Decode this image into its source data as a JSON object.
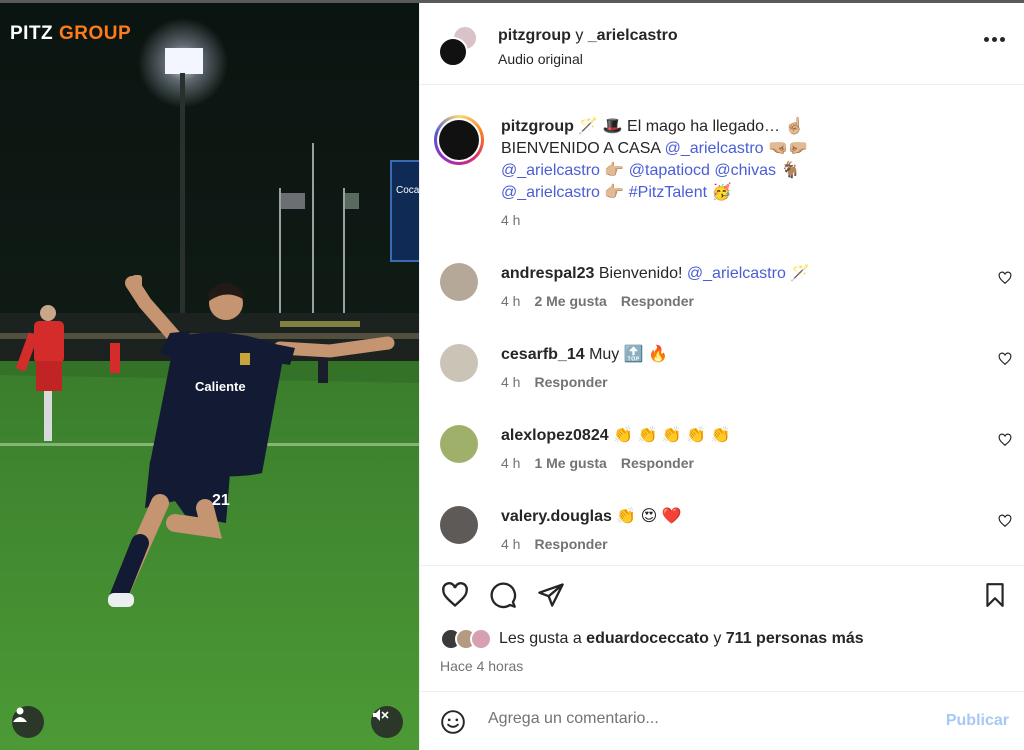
{
  "media": {
    "brand_prefix": "PITZ",
    "brand_suffix": "GROUP",
    "jersey_sponsor": "Caliente",
    "stadium_sign": "Coca-Cola",
    "player_number": "21"
  },
  "header": {
    "user1": "pitzgroup",
    "conjunction": "y",
    "user2": "_arielcastro",
    "subtitle": "Audio original"
  },
  "caption": {
    "username": "pitzgroup",
    "text1": " 🪄 🎩 El mago ha llegado… ☝🏼",
    "text2": "BIENVENIDO A CASA ",
    "mention1": "@_arielcastro",
    "emoji2": " 🤜🏼🤛🏼",
    "mention2": "@_arielcastro",
    "emoji3": " 👉🏼 ",
    "mention3": "@tapatiocd",
    "mention4": "@chivas",
    "emoji4": " 🐐",
    "mention5": "@_arielcastro",
    "emoji5": " 👉🏼 ",
    "hashtag": "#PitzTalent",
    "emoji6": " 🥳",
    "time": "4 h"
  },
  "comments": [
    {
      "username": "andrespal23",
      "text": " Bienvenido! ",
      "mention": "@_arielcastro",
      "emoji": " 🪄",
      "time": "4 h",
      "likes": "2 Me gusta",
      "reply": "Responder",
      "avatar_color": "#b5a898"
    },
    {
      "username": "cesarfb_14",
      "text": " Muy ",
      "mention": "",
      "emoji": "🔝 🔥",
      "time": "4 h",
      "likes": "",
      "reply": "Responder",
      "avatar_color": "#c9c4b5"
    },
    {
      "username": "alexlopez0824",
      "text": " ",
      "mention": "",
      "emoji": "👏 👏 👏 👏 👏",
      "time": "4 h",
      "likes": "1 Me gusta",
      "reply": "Responder",
      "avatar_color": "#9fb06a"
    },
    {
      "username": "valery.douglas",
      "text": " ",
      "mention": "",
      "emoji": "👏 😍 ❤️",
      "time": "4 h",
      "likes": "",
      "reply": "Responder",
      "avatar_color": "#5d5a57"
    }
  ],
  "likes": {
    "prefix": "Les gusta a ",
    "user": "eduardoceccato",
    "middle": " y ",
    "count": "711 personas más",
    "time": "Hace 4 horas"
  },
  "add_comment": {
    "placeholder": "Agrega un comentario...",
    "publish": "Publicar"
  },
  "colors": {
    "link": "#4a5dd6",
    "publish_disabled": "#a6c8f5",
    "jersey": "#111a33",
    "pitch": "#3f8a2c"
  }
}
